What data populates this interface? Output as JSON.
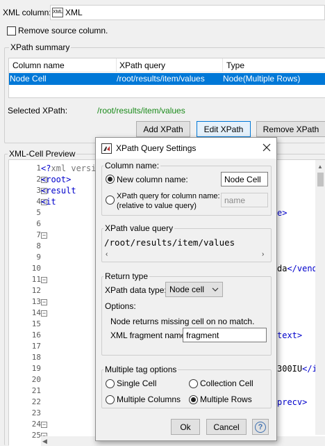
{
  "xml_column": {
    "label": "XML column:",
    "icon_text": "XML",
    "value": "XML"
  },
  "remove_source": {
    "label": "Remove source column.",
    "checked": false
  },
  "xpath_summary": {
    "title": "XPath summary",
    "headers": [
      "Column name",
      "XPath query",
      "Type"
    ],
    "rows": [
      {
        "column_name": "Node Cell",
        "xpath_query": "/root/results/item/values",
        "type": "Node(Multiple Rows)"
      }
    ],
    "selected_label": "Selected XPath:",
    "selected_value": "/root/results/item/values",
    "buttons": {
      "add": "Add XPath",
      "edit": "Edit XPath",
      "remove": "Remove XPath"
    }
  },
  "preview": {
    "title": "XML-Cell Preview",
    "lines": [
      {
        "n": "1",
        "text": "<?xml versi",
        "fold": false
      },
      {
        "n": "2",
        "text": "<root>",
        "fold": true
      },
      {
        "n": "3",
        "text": "    <result",
        "fold": true
      },
      {
        "n": "4",
        "text": "        <it",
        "fold": true
      },
      {
        "n": "5",
        "text": "",
        "fold": false
      },
      {
        "n": "6",
        "text": "",
        "fold": false
      },
      {
        "n": "7",
        "text": "",
        "fold": true
      },
      {
        "n": "8",
        "text": "",
        "fold": false
      },
      {
        "n": "9",
        "text": "",
        "fold": false
      },
      {
        "n": "10",
        "text": "",
        "fold": false
      },
      {
        "n": "11",
        "text": "",
        "fold": true
      },
      {
        "n": "12",
        "text": "",
        "fold": false
      },
      {
        "n": "13",
        "text": "",
        "fold": true
      },
      {
        "n": "14",
        "text": "",
        "fold": true
      },
      {
        "n": "15",
        "text": "",
        "fold": false
      },
      {
        "n": "16",
        "text": "",
        "fold": false
      },
      {
        "n": "17",
        "text": "",
        "fold": false
      },
      {
        "n": "18",
        "text": "",
        "fold": false
      },
      {
        "n": "19",
        "text": "",
        "fold": false
      },
      {
        "n": "20",
        "text": "",
        "fold": false
      },
      {
        "n": "21",
        "text": "",
        "fold": false
      },
      {
        "n": "22",
        "text": "",
        "fold": false
      },
      {
        "n": "23",
        "text": "",
        "fold": false
      },
      {
        "n": "24",
        "text": "",
        "fold": true
      },
      {
        "n": "25",
        "text": "",
        "fold": true
      }
    ],
    "right_fragments": {
      "l5": "e>",
      "l10": "da</vendo",
      "l16": "text>",
      "l19": "300IU</i",
      "l22": "precv>"
    }
  },
  "dialog": {
    "title": "XPath Query Settings",
    "column_name": {
      "group_title": "Column name:",
      "new_label": "New column name:",
      "new_value": "Node Cell",
      "xpath_label_line1": "XPath query for column name:",
      "xpath_label_line2": "(relative to value query)",
      "xpath_placeholder": "name",
      "selected": "new"
    },
    "value_query": {
      "group_title": "XPath value query",
      "value": "/root/results/item/values"
    },
    "return_type": {
      "group_title": "Return type",
      "data_type_label": "XPath data type:",
      "data_type_value": "Node cell",
      "options_label": "Options:",
      "missing_text": "Node returns missing cell on no match.",
      "fragment_label": "XML fragment name:",
      "fragment_value": "fragment"
    },
    "multiple_tag": {
      "group_title": "Multiple tag options",
      "options": [
        "Single Cell",
        "Collection Cell",
        "Multiple Columns",
        "Multiple Rows"
      ],
      "selected": "Multiple Rows"
    },
    "buttons": {
      "ok": "Ok",
      "cancel": "Cancel",
      "help": "?"
    }
  }
}
